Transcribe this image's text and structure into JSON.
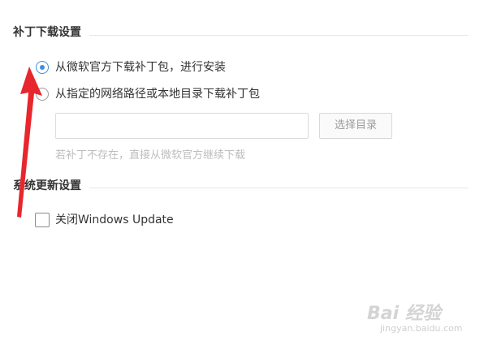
{
  "patch_download": {
    "title": "补丁下载设置",
    "option_official": "从微软官方下载补丁包，进行安装",
    "option_custom": "从指定的网络路径或本地目录下载补丁包",
    "path_value": "",
    "path_placeholder": "",
    "browse_label": "选择目录",
    "hint": "若补丁不存在，直接从微软官方继续下载",
    "selected": "official"
  },
  "system_update": {
    "title": "系统更新设置",
    "disable_update_label": "关闭Windows Update",
    "disable_update_checked": false
  },
  "watermark": {
    "logo_text": "Bai 经验",
    "url": "jingyan.baidu.com"
  },
  "colors": {
    "accent": "#3b8fe0",
    "annotation_arrow": "#e8262d"
  }
}
